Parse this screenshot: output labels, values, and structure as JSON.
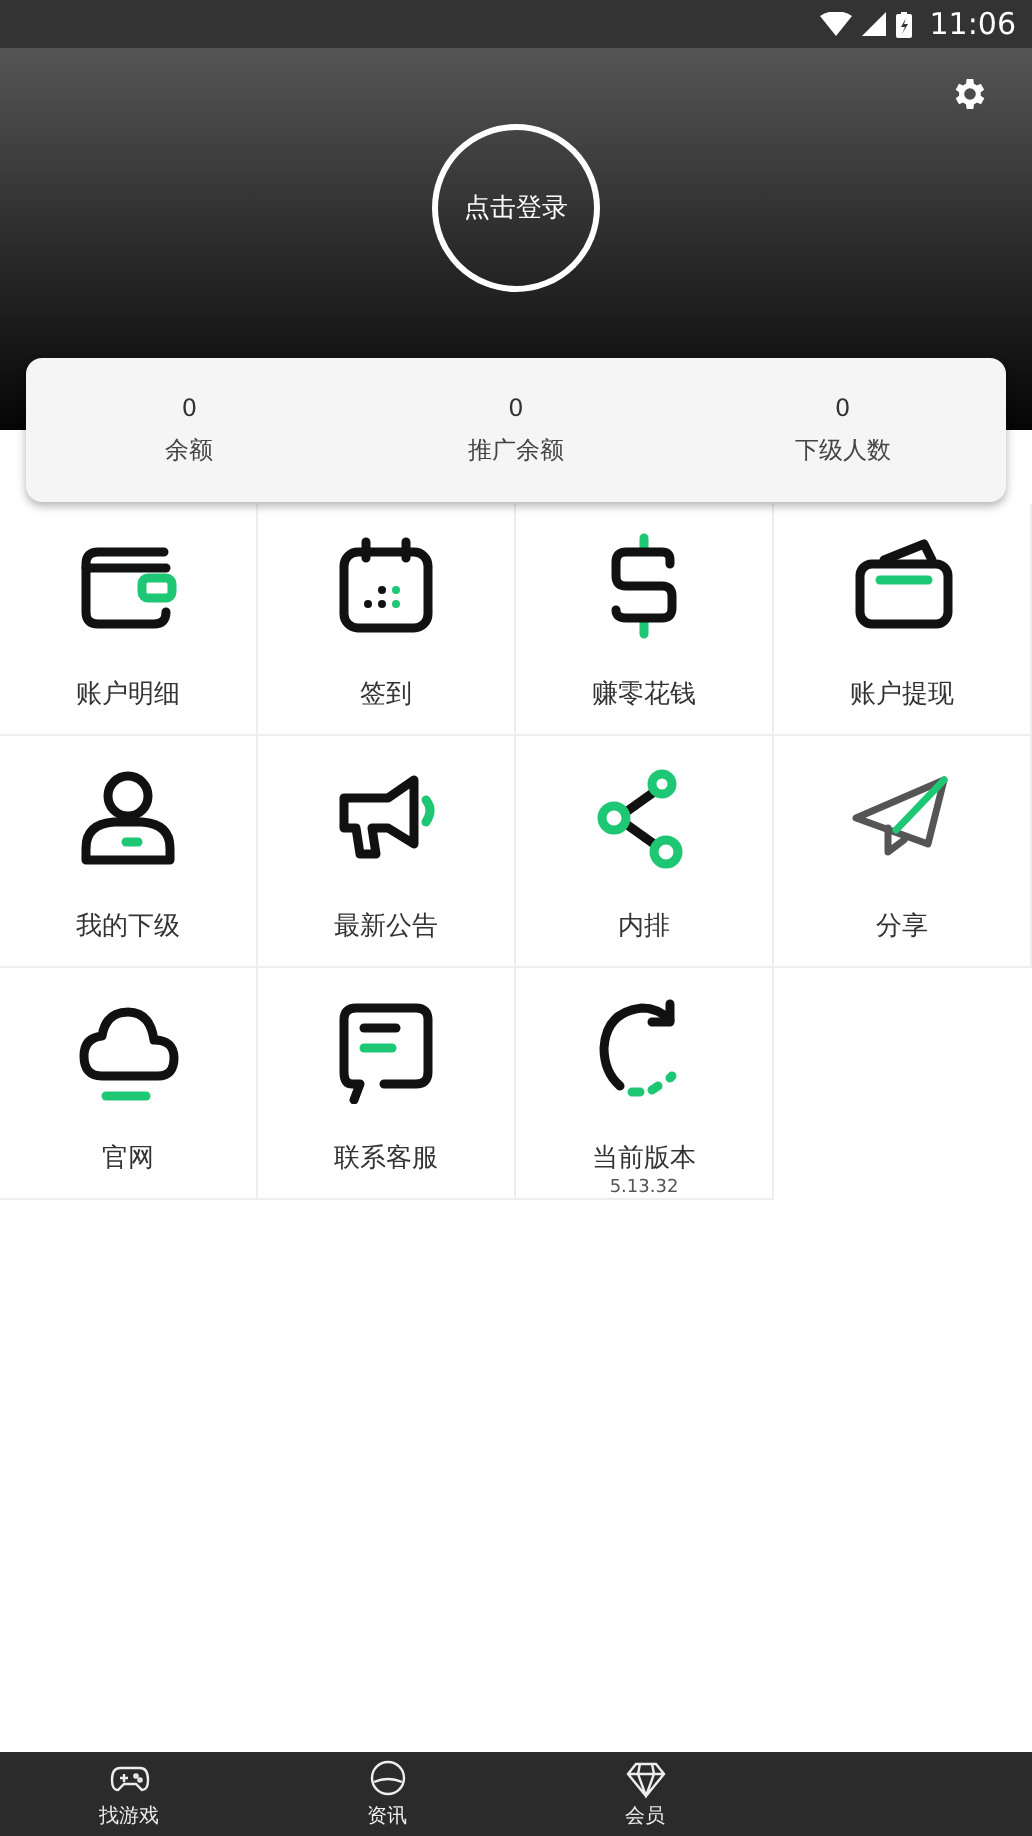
{
  "status_bar": {
    "time": "11:06"
  },
  "header": {
    "login": "点击登录"
  },
  "stats": [
    {
      "value": "0",
      "label": "余额"
    },
    {
      "value": "0",
      "label": "推广余额"
    },
    {
      "value": "0",
      "label": "下级人数"
    }
  ],
  "tiles": [
    {
      "label": "账户明细"
    },
    {
      "label": "签到"
    },
    {
      "label": "赚零花钱"
    },
    {
      "label": "账户提现"
    },
    {
      "label": "我的下级"
    },
    {
      "label": "最新公告"
    },
    {
      "label": "内排"
    },
    {
      "label": "分享"
    },
    {
      "label": "官网"
    },
    {
      "label": "联系客服"
    },
    {
      "label": "当前版本",
      "sub": "5.13.32"
    }
  ],
  "nav": [
    {
      "label": "找游戏"
    },
    {
      "label": "资讯"
    },
    {
      "label": "会员"
    }
  ]
}
